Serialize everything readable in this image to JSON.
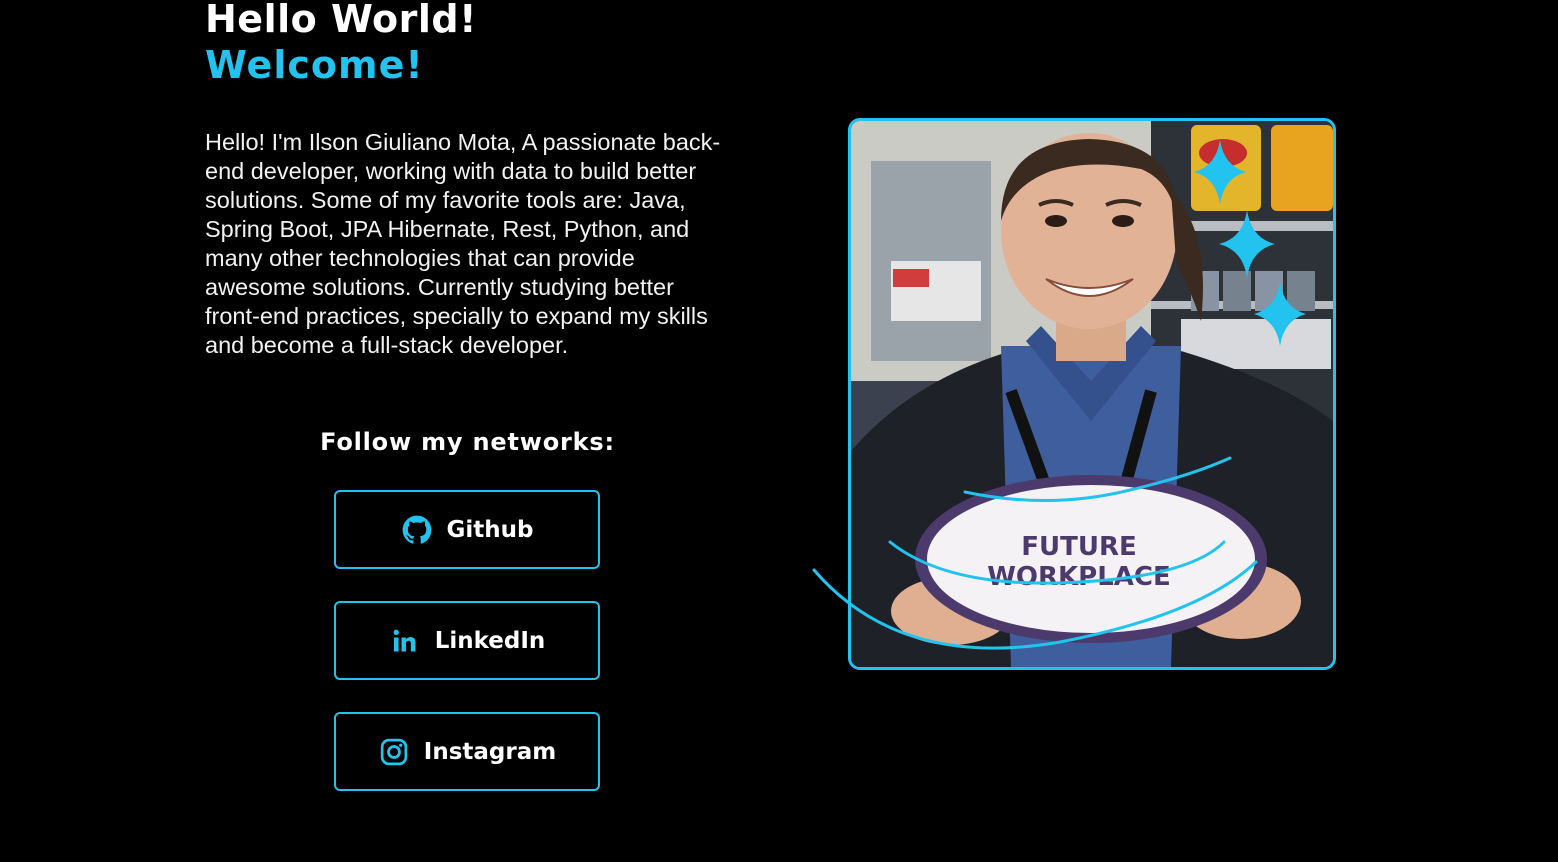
{
  "hero": {
    "greeting": "Hello World!",
    "welcome": "Welcome!",
    "bio": "Hello! I'm Ilson Giuliano Mota, A passionate back-end developer, working with data to build better solutions. Some of my favorite tools are: Java, Spring Boot, JPA Hibernate, Rest, Python, and many other technologies that can provide awesome solutions. Currently studying better front-end practices, specially to expand my skills and become a full-stack developer."
  },
  "networks": {
    "heading": "Follow my networks:",
    "items": [
      {
        "label": "Github",
        "icon": "github-icon"
      },
      {
        "label": "LinkedIn",
        "icon": "linkedin-icon"
      },
      {
        "label": "Instagram",
        "icon": "instagram-icon"
      }
    ]
  },
  "photo": {
    "sign_line1": "FUTURE",
    "sign_line2": "WORKPLACE"
  },
  "colors": {
    "background": "#000000",
    "accent": "#22c3ee",
    "text": "#ffffff"
  }
}
